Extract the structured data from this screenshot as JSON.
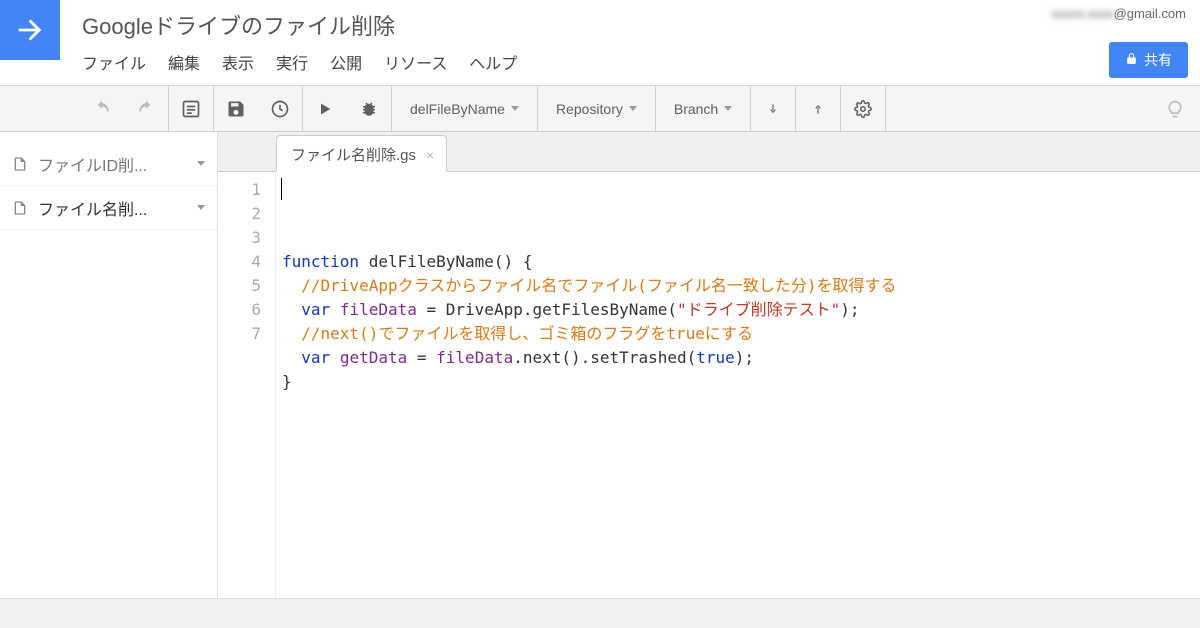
{
  "header": {
    "title": "Googleドライブのファイル削除",
    "user_email_suffix": "@gmail.com",
    "share_label": "共有"
  },
  "menu": {
    "file": "ファイル",
    "edit": "編集",
    "view": "表示",
    "run": "実行",
    "publish": "公開",
    "resource": "リソース",
    "help": "ヘルプ"
  },
  "toolbar": {
    "func_selector": "delFileByName",
    "repo_label": "Repository",
    "branch_label": "Branch"
  },
  "sidebar": {
    "items": [
      {
        "label": "ファイルID削...",
        "active": false
      },
      {
        "label": "ファイル名削...",
        "active": true
      }
    ]
  },
  "tabs": {
    "active_label": "ファイル名削除.gs"
  },
  "code": {
    "lines": [
      {
        "tokens": [
          {
            "t": "function",
            "c": "kw"
          },
          {
            "t": " delFileByName",
            "c": "fn"
          },
          {
            "t": "() {",
            "c": ""
          }
        ]
      },
      {
        "indent": 2,
        "tokens": [
          {
            "t": "//DriveAppクラスからファイル名でファイル(ファイル名一致した分)を取得する",
            "c": "cmt"
          }
        ]
      },
      {
        "indent": 2,
        "tokens": [
          {
            "t": "var",
            "c": "kw"
          },
          {
            "t": " ",
            "c": ""
          },
          {
            "t": "fileData",
            "c": "var"
          },
          {
            "t": " = DriveApp.getFilesByName(",
            "c": ""
          },
          {
            "t": "\"ドライブ削除テスト\"",
            "c": "str"
          },
          {
            "t": ");",
            "c": ""
          }
        ]
      },
      {
        "indent": 2,
        "tokens": [
          {
            "t": "//next()でファイルを取得し、ゴミ箱のフラグをtrueにする",
            "c": "cmt"
          }
        ]
      },
      {
        "indent": 2,
        "tokens": [
          {
            "t": "var",
            "c": "kw"
          },
          {
            "t": " ",
            "c": ""
          },
          {
            "t": "getData",
            "c": "var"
          },
          {
            "t": " = ",
            "c": ""
          },
          {
            "t": "fileData",
            "c": "var"
          },
          {
            "t": ".next().setTrashed(",
            "c": ""
          },
          {
            "t": "true",
            "c": "bool"
          },
          {
            "t": ");",
            "c": ""
          }
        ]
      },
      {
        "tokens": [
          {
            "t": "}",
            "c": ""
          }
        ]
      },
      {
        "tokens": []
      }
    ]
  }
}
